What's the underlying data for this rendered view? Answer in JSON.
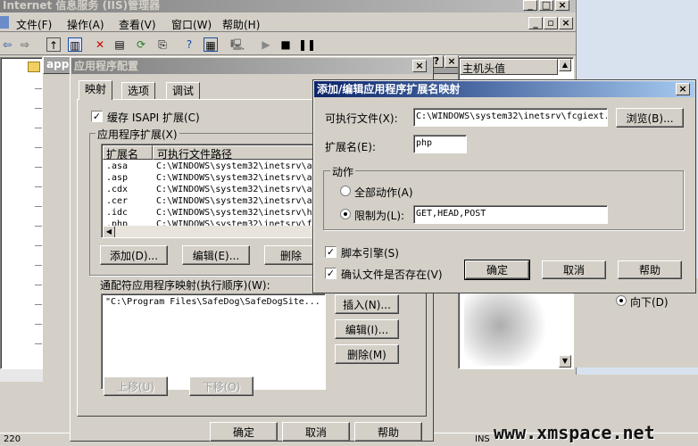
{
  "main_window": {
    "title": "Internet 信息服务 (IIS)管理器",
    "menu": [
      "文件(F)",
      "操作(A)",
      "查看(V)",
      "窗口(W)",
      "帮助(H)"
    ],
    "header_fragment": "appl",
    "right_header": "主机头值",
    "right_radio_label": "向下(D)",
    "status_left": "220",
    "status_right": "INS"
  },
  "app_config": {
    "title": "应用程序配置",
    "tabs": [
      "映射",
      "选项",
      "调试"
    ],
    "cache_isapi": "缓存 ISAPI 扩展(C)",
    "extensions_group": "应用程序扩展(X)",
    "columns": [
      "扩展名",
      "可执行文件路径"
    ],
    "rows": [
      {
        "ext": ".asa",
        "path": "C:\\WINDOWS\\system32\\inetsrv\\a"
      },
      {
        "ext": ".asp",
        "path": "C:\\WINDOWS\\system32\\inetsrv\\a"
      },
      {
        "ext": ".cdx",
        "path": "C:\\WINDOWS\\system32\\inetsrv\\a"
      },
      {
        "ext": ".cer",
        "path": "C:\\WINDOWS\\system32\\inetsrv\\a"
      },
      {
        "ext": ".idc",
        "path": "C:\\WINDOWS\\system32\\inetsrv\\h"
      },
      {
        "ext": ".php",
        "path": "C:\\WINDOWS\\system32\\inetsrv\\f"
      }
    ],
    "add_button": "添加(D)...",
    "edit_button": "编辑(E)...",
    "delete_button": "删除",
    "wildcard_label": "通配符应用程序映射(执行顺序)(W):",
    "wildcard_item": "\"C:\\Program Files\\SafeDog\\SafeDogSite...",
    "insert_button": "插入(N)...",
    "edit2_button": "编辑(I)...",
    "delete2_button": "删除(M)",
    "up_button": "上移(U)",
    "down_button": "下移(O)",
    "ok": "确定",
    "cancel": "取消",
    "help": "帮助"
  },
  "ext_dialog": {
    "title": "添加/编辑应用程序扩展名映射",
    "exec_label": "可执行文件(X):",
    "exec_value": "C:\\WINDOWS\\system32\\inetsrv\\fcgiext.",
    "browse": "浏览(B)...",
    "ext_label": "扩展名(E):",
    "ext_value": "php",
    "action_group": "动作",
    "all_verbs": "全部动作(A)",
    "limit_to": "限制为(L):",
    "verbs_value": "GET,HEAD,POST",
    "script_engine": "脚本引擎(S)",
    "verify_file": "确认文件是否存在(V)",
    "ok": "确定",
    "cancel": "取消",
    "help": "帮助"
  },
  "watermark": "www.xmspace.net",
  "colors": {
    "title_active": "#0a246a",
    "title_inactive": "#808080",
    "face": "#d4d0c8"
  }
}
